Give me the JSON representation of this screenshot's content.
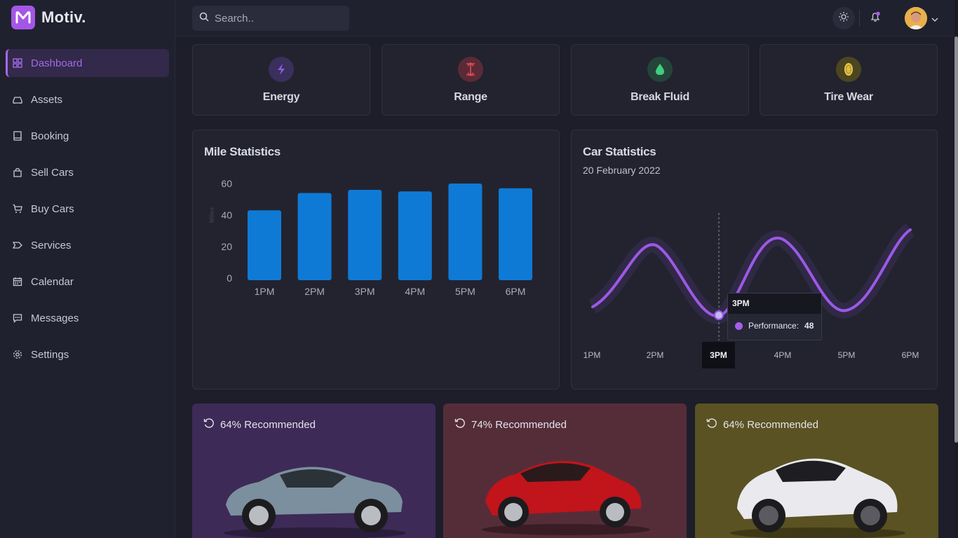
{
  "brand": {
    "name": "Motiv."
  },
  "sidebar": {
    "items": [
      {
        "label": "Dashboard",
        "icon": "grid-icon",
        "active": true
      },
      {
        "label": "Assets",
        "icon": "car-icon"
      },
      {
        "label": "Booking",
        "icon": "book-icon"
      },
      {
        "label": "Sell Cars",
        "icon": "bag-icon"
      },
      {
        "label": "Buy Cars",
        "icon": "cart-icon"
      },
      {
        "label": "Services",
        "icon": "tag-icon"
      },
      {
        "label": "Calendar",
        "icon": "calendar-icon"
      },
      {
        "label": "Messages",
        "icon": "message-icon"
      },
      {
        "label": "Settings",
        "icon": "gear-icon"
      }
    ]
  },
  "topbar": {
    "search_placeholder": "Search.."
  },
  "stats": [
    {
      "label": "Energy",
      "icon": "bolt-icon",
      "color": "#8a5ce6"
    },
    {
      "label": "Range",
      "icon": "range-icon",
      "color": "#e04a5a"
    },
    {
      "label": "Break Fluid",
      "icon": "drop-icon",
      "color": "#3fcf7e"
    },
    {
      "label": "Tire Wear",
      "icon": "tire-icon",
      "color": "#e8c84a"
    }
  ],
  "mile_statistics": {
    "title": "Mile Statistics",
    "chart_data": {
      "type": "bar",
      "categories": [
        "1PM",
        "2PM",
        "3PM",
        "4PM",
        "5PM",
        "6PM"
      ],
      "values": [
        43,
        54,
        56,
        55,
        60,
        57
      ],
      "ylabel": "Miles",
      "yticks": [
        0,
        20,
        40,
        60,
        80
      ],
      "ylim": [
        0,
        80
      ],
      "color": "#0f7ad6"
    }
  },
  "car_statistics": {
    "title": "Car Statistics",
    "date": "20 February 2022",
    "chart_data": {
      "type": "line",
      "categories": [
        "1PM",
        "2PM",
        "3PM",
        "4PM",
        "5PM",
        "6PM"
      ],
      "series": [
        {
          "name": "Performance",
          "color": "#9b59e6"
        }
      ],
      "tooltip": {
        "x": "3PM",
        "label": "Performance:",
        "value": "48"
      }
    }
  },
  "cars": [
    {
      "recommended": "64% Recommended",
      "bg": "#3d2a57",
      "car_color": "#7c8f9e"
    },
    {
      "recommended": "74% Recommended",
      "bg": "#552d39",
      "car_color": "#c1141b"
    },
    {
      "recommended": "64% Recommended",
      "bg": "#5a5222",
      "car_color": "#e9e9ee"
    }
  ]
}
